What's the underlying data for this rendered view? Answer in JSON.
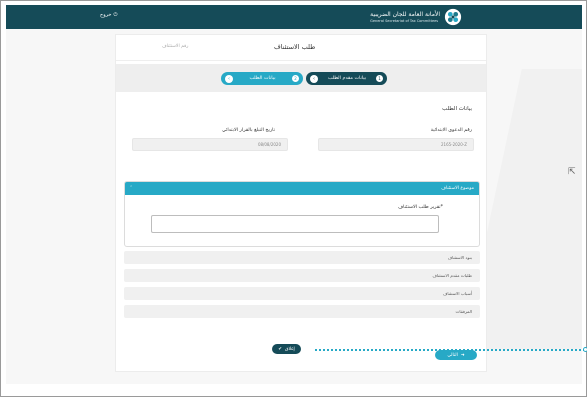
{
  "header": {
    "logout_label": "خروج",
    "brand_ar": "الأمانة العامة للجان الضريبية",
    "brand_en": "General Secretariat of Tax Committees"
  },
  "card": {
    "title": "طلب الاستئناف",
    "request_number_label": "رقم الاستئناف"
  },
  "steps": [
    {
      "number": "1",
      "label": "بيانات مقدم الطلب",
      "active": true
    },
    {
      "number": "2",
      "label": "بيانات الطلب",
      "active": false
    }
  ],
  "section": {
    "title": "بيانات الطلب"
  },
  "fields": {
    "case_number_label": "رقم الدعوى الابتدائية",
    "case_number_value": "2165-2020-Z",
    "notify_date_label": "تاريخ التبلغ بالقرار الابتدائي",
    "notify_date_value": "08/08/2020"
  },
  "appeal_panel": {
    "heading": "موضوع الاستئناف",
    "input_label": "تقرير طلب الاستئناف*"
  },
  "accordions": [
    "بنود الاستئناف",
    "طلبات مقدم الاستئناف",
    "أسباب الاستئناف",
    "المرفقات"
  ],
  "buttons": {
    "close_label": "إغلاق",
    "next_label": "التالي"
  },
  "colors": {
    "primary_dark": "#154b58",
    "accent": "#27a9c6"
  }
}
